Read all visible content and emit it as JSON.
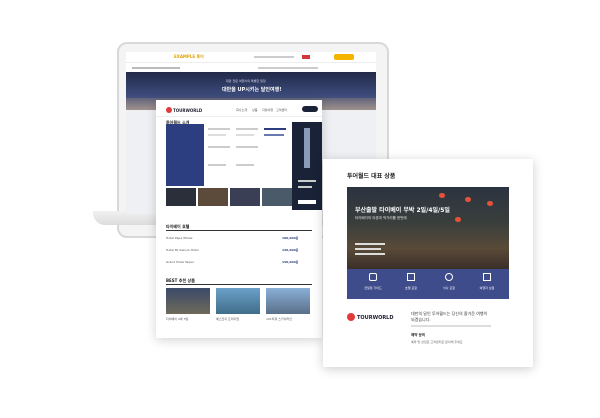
{
  "laptop": {
    "site_name": "EXAMPLE 투어",
    "hero_headline": "대만을 UP시키는 달인여행!",
    "hero_sub": "대만 전문 여행사의 특별한 일정"
  },
  "website": {
    "logo": "TOURWORLD",
    "nav": [
      "회사소개",
      "상품",
      "자유여행",
      "고객센터",
      "문의하기"
    ],
    "intro_title": "투어월드 소개",
    "hotel_title": "타이베이 호텔",
    "hotel_rows": [
      {
        "name": "Hotel Papa Whale",
        "price": "100,000원"
      },
      {
        "name": "Hotel Mi Sakura Hotel",
        "price": "120,000원"
      },
      {
        "name": "Grand Hotel Taipei",
        "price": "150,000원"
      }
    ],
    "products_title": "BEST 추천 상품",
    "products": [
      {
        "name": "타이베이 2박 3일"
      },
      {
        "name": "예스진지 프리미엄"
      },
      {
        "name": "101타워 스카이라인"
      }
    ]
  },
  "card": {
    "section_title": "투어월드 대표 상품",
    "photo_title": "부산출발 타이베이 무박 2일/4일/5일",
    "photo_sub": "타이베이의 야경과 먹거리를 한번에",
    "features": [
      "전일정 가이드",
      "호텔 포함",
      "식사 포함",
      "여행자 보험"
    ],
    "logo": "TOURWORLD",
    "blurb_line1": "대만의 달인 투어월드는 당신의 즐거운 여행이",
    "blurb_line2": "되겠습니다.",
    "contact_label": "예약 문의",
    "contact_detail": "예약 및 상담은 고객센터로 문의해 주세요"
  }
}
